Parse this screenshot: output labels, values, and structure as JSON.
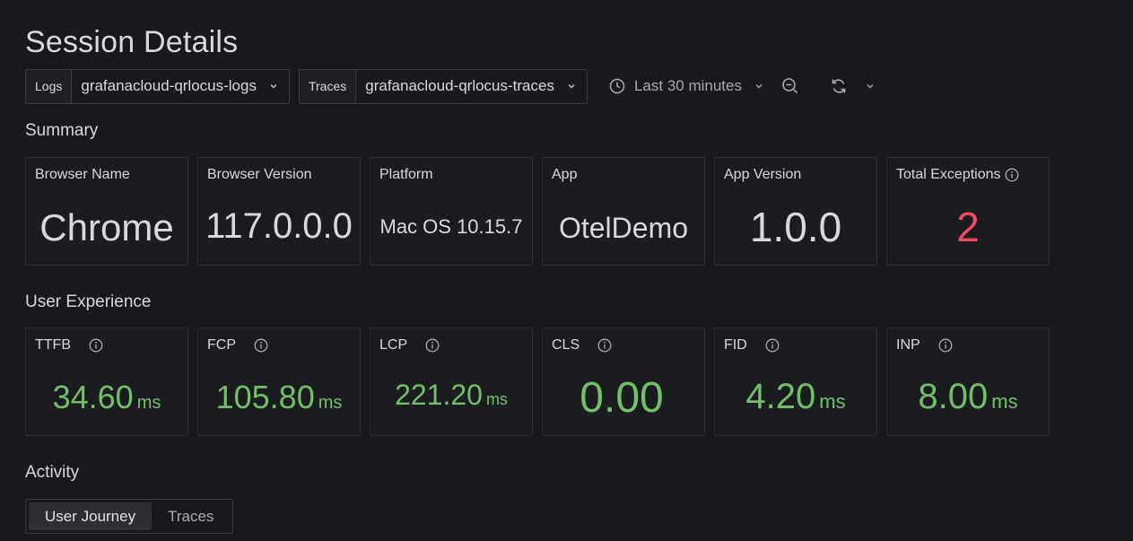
{
  "page": {
    "title": "Session Details"
  },
  "toolbar": {
    "logs": {
      "label": "Logs",
      "value": "grafanacloud-qrlocus-logs"
    },
    "traces": {
      "label": "Traces",
      "value": "grafanacloud-qrlocus-traces"
    },
    "time_range": "Last 30 minutes",
    "icons": [
      "clock-icon",
      "zoom-out-icon",
      "refresh-icon",
      "chevron-down-icon"
    ]
  },
  "summary": {
    "title": "Summary",
    "cards": [
      {
        "label": "Browser Name",
        "value": "Chrome"
      },
      {
        "label": "Browser Version",
        "value": "117.0.0.0"
      },
      {
        "label": "Platform",
        "value": "Mac OS 10.15.7"
      },
      {
        "label": "App",
        "value": "OtelDemo"
      },
      {
        "label": "App Version",
        "value": "1.0.0"
      },
      {
        "label": "Total Exceptions",
        "value": "2"
      }
    ]
  },
  "user_experience": {
    "title": "User Experience",
    "metrics": [
      {
        "label": "TTFB",
        "value": "34.60",
        "unit": "ms"
      },
      {
        "label": "FCP",
        "value": "105.80",
        "unit": "ms"
      },
      {
        "label": "LCP",
        "value": "221.20",
        "unit": "ms"
      },
      {
        "label": "CLS",
        "value": "0.00",
        "unit": ""
      },
      {
        "label": "FID",
        "value": "4.20",
        "unit": "ms"
      },
      {
        "label": "INP",
        "value": "8.00",
        "unit": "ms"
      }
    ]
  },
  "activity": {
    "title": "Activity",
    "tabs": [
      {
        "label": "User Journey",
        "active": true
      },
      {
        "label": "Traces",
        "active": false
      }
    ]
  },
  "colors": {
    "background": "#18191d",
    "card_border": "#2e2f35",
    "good": "#73bf69",
    "error": "#f2495c",
    "text": "#d8d9dc"
  }
}
